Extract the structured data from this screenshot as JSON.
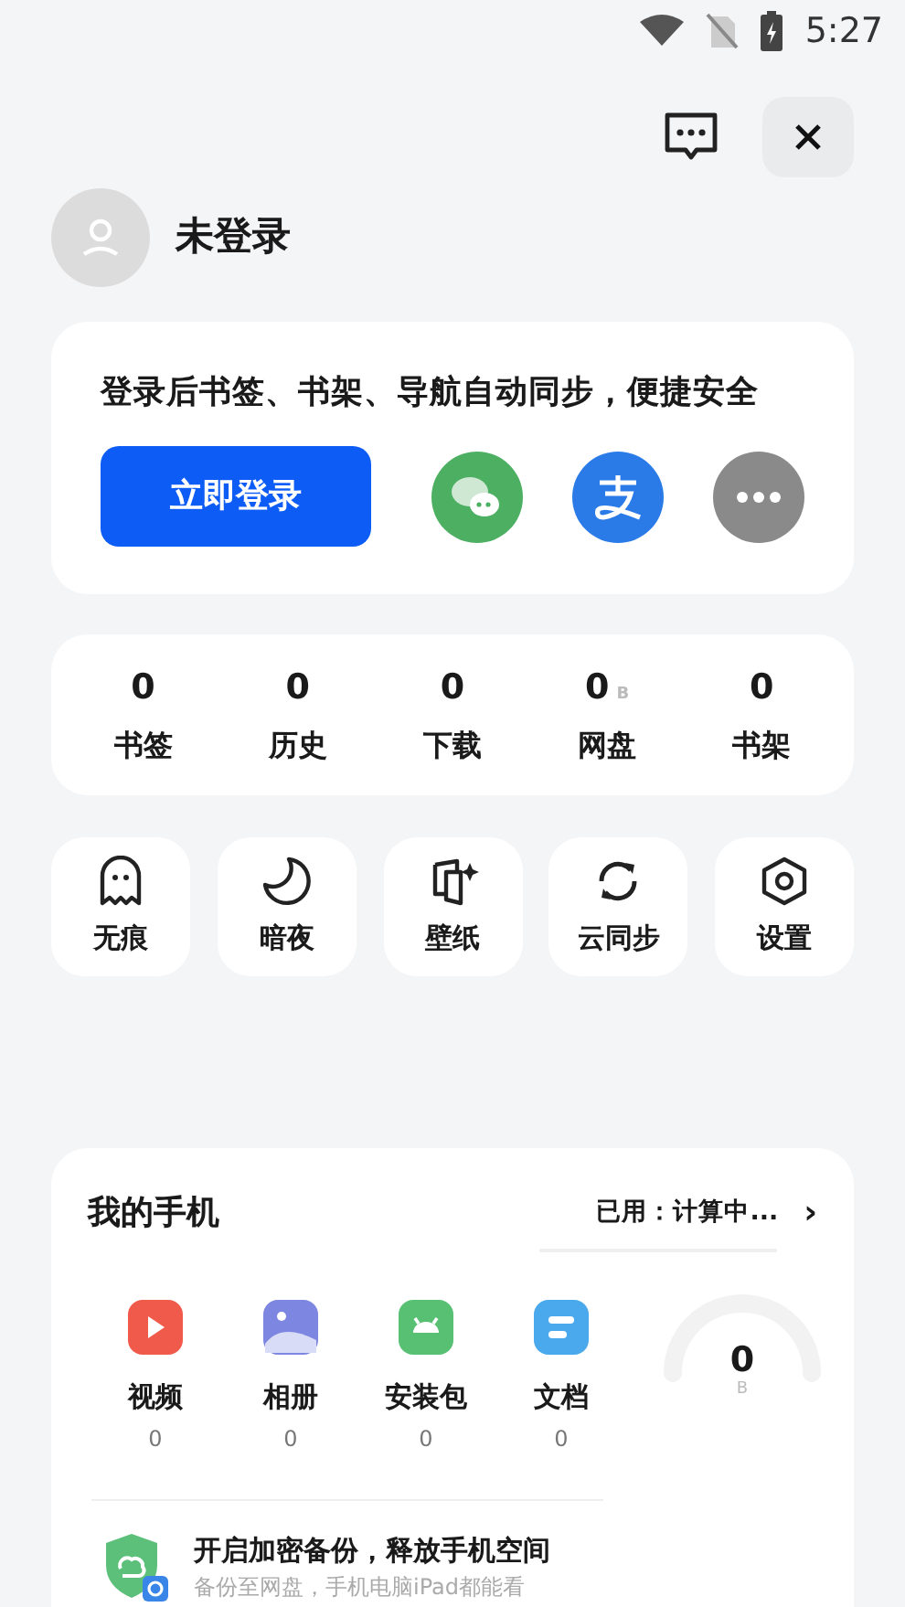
{
  "status_bar": {
    "time": "5:27"
  },
  "user": {
    "name": "未登录"
  },
  "login_card": {
    "prompt": "登录后书签、书架、导航自动同步，便捷安全",
    "button": "立即登录",
    "methods": [
      {
        "kind": "wechat",
        "color": "#4caf62"
      },
      {
        "kind": "alipay",
        "color": "#2a7be8"
      },
      {
        "kind": "more",
        "color": "#8a8a8a"
      }
    ]
  },
  "stats": [
    {
      "value": "0",
      "label": "书签"
    },
    {
      "value": "0",
      "label": "历史"
    },
    {
      "value": "0",
      "label": "下载"
    },
    {
      "value": "0",
      "unit": "B",
      "label": "网盘"
    },
    {
      "value": "0",
      "label": "书架"
    }
  ],
  "tools": [
    {
      "kind": "ghost",
      "label": "无痕"
    },
    {
      "kind": "moon",
      "label": "暗夜"
    },
    {
      "kind": "wallpaper",
      "label": "壁纸"
    },
    {
      "kind": "sync",
      "label": "云同步"
    },
    {
      "kind": "settings",
      "label": "设置"
    }
  ],
  "phone": {
    "title": "我的手机",
    "usage": "已用：计算中...",
    "chevron": "›",
    "categories": [
      {
        "kind": "video",
        "label": "视频",
        "count": "0"
      },
      {
        "kind": "album",
        "label": "相册",
        "count": "0"
      },
      {
        "kind": "apk",
        "label": "安装包",
        "count": "0"
      },
      {
        "kind": "doc",
        "label": "文档",
        "count": "0"
      }
    ],
    "gauge": {
      "value": "0",
      "unit": "B"
    },
    "backup": {
      "title": "开启加密备份，释放手机空间",
      "subtitle": "备份至网盘，手机电脑iPad都能看"
    }
  }
}
